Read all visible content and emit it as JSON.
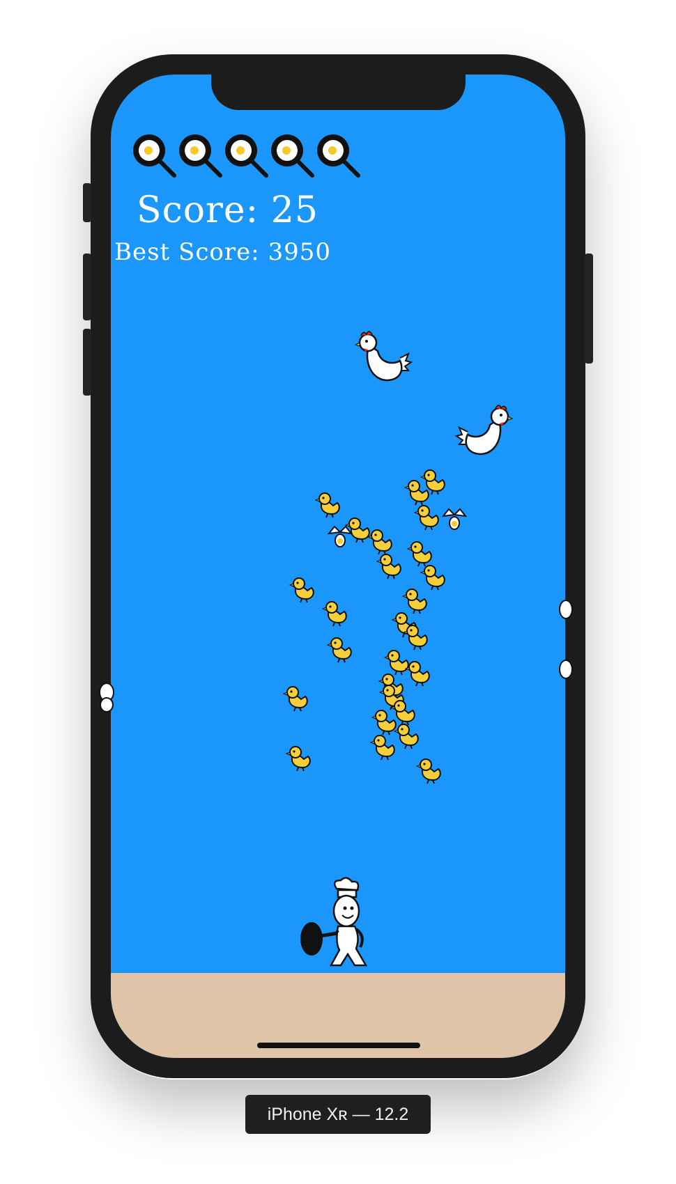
{
  "hud": {
    "lives": [
      "frying-pan-egg",
      "frying-pan-egg",
      "frying-pan-egg",
      "frying-pan-egg",
      "frying-pan-egg"
    ],
    "score_text": "Score: 25",
    "best_score_text": "Best Score: 3950"
  },
  "device": {
    "label": "iPhone Xʀ — 12.2"
  },
  "colors": {
    "sky": "#1b96fa",
    "ground": "#dfc4a7",
    "chick": "#f5cf3b",
    "device_frame": "#1c1c1c"
  }
}
